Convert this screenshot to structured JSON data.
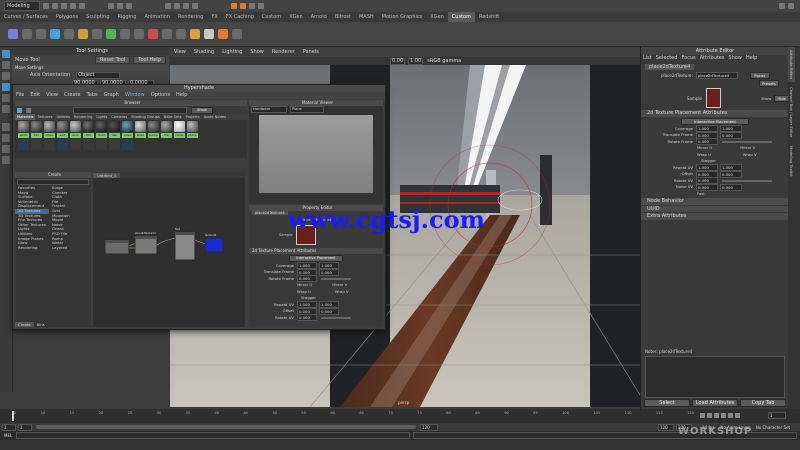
{
  "menu": {
    "mode": "Modeling"
  },
  "shelf": {
    "tabs": [
      "Curves / Surfaces",
      "Polygons",
      "Sculpting",
      "Rigging",
      "Animation",
      "Rendering",
      "FX",
      "FX Caching",
      "Custom",
      "XGen",
      "Arnold",
      "Bifrost",
      "MASH",
      "Motion Graphics",
      "XGen",
      "Custom",
      "Redshift"
    ],
    "active_index": 15,
    "accent": "#e07b2a"
  },
  "tool_settings": {
    "title": "Tool Settings",
    "tool": "Move Tool",
    "reset": "Reset Tool",
    "help": "Tool Help",
    "section": "Move Settings",
    "axis_label": "Axis Orientation",
    "axis_value": "Object",
    "coords": [
      "90.0000",
      "90.0000",
      "0.0000"
    ]
  },
  "viewport": {
    "menus": [
      "View",
      "Shading",
      "Lighting",
      "Show",
      "Renderer",
      "Panels"
    ],
    "gamma": "sRGB gamma",
    "values": [
      "0.00",
      "1.00"
    ],
    "camera": "persp"
  },
  "hypershade": {
    "title": "Hypershade",
    "menus": [
      "File",
      "Edit",
      "View",
      "Create",
      "Tabs",
      "Graph",
      "Window",
      "Options",
      "Help"
    ],
    "hot_menu_index": 6,
    "browser_title": "Browser",
    "browser_tabs": [
      "Materials",
      "Textures",
      "Utilities",
      "Rendering",
      "Lights",
      "Cameras",
      "Shading Groups",
      "Bake Sets",
      "Projects",
      "Asset Nodes"
    ],
    "show_label": "Show",
    "swatch_labels": [
      "lamb",
      "blin",
      "phon",
      "surf",
      "anis",
      "stin",
      "fluid",
      "hair",
      "ocea",
      "shad",
      "bump",
      "file",
      "ramp",
      "place"
    ],
    "material_viewer_title": "Material Viewer",
    "material_viewer_options": [
      "Hardware",
      "Plane"
    ],
    "create_title": "Create",
    "create_tree": [
      "Favorites",
      "Maya",
      "Surface",
      "Volumetric",
      "Displacement",
      "2D Textures",
      "3D Textures",
      "Env Textures",
      "Other Textures",
      "Lights",
      "Utilities",
      "Image Planes",
      "Glow",
      "Rendering"
    ],
    "create_selected": 5,
    "create_nodes": [
      "Bulge",
      "Checker",
      "Cloth",
      "File",
      "Fractal",
      "Grid",
      "Mountain",
      "Movie",
      "Noise",
      "Ocean",
      "PSD File",
      "Ramp",
      "Water",
      "Layered"
    ],
    "work_tab": "Untitled_1",
    "create_tab": "Create",
    "bins_tab": "Bins",
    "node_labels": [
      "place2dTexture4",
      "file1",
      "lambert2"
    ]
  },
  "property_editor": {
    "title": "Property Editor",
    "node_tab": "place2dTexture4",
    "node_name": "place2dTexture4",
    "sample": "Sample",
    "section": "2d Texture Placement Attributes",
    "interactive": "Interactive Placement",
    "rows": [
      {
        "label": "Coverage",
        "a": "1.000",
        "b": "1.000"
      },
      {
        "label": "Translate Frame",
        "a": "0.000",
        "b": "0.000"
      },
      {
        "label": "Rotate Frame",
        "a": "0.000",
        "b": ""
      }
    ],
    "checks": [
      "Mirror U",
      "Mirror V",
      "Wrap U",
      "Wrap V",
      "Stagger"
    ],
    "rows2": [
      {
        "label": "Repeat UV",
        "a": "1.000",
        "b": "1.000"
      },
      {
        "label": "Offset",
        "a": "0.000",
        "b": "0.000"
      },
      {
        "label": "Rotate UV",
        "a": "0.000",
        "b": ""
      }
    ]
  },
  "attribute_editor": {
    "title": "Attribute Editor",
    "menus": [
      "List",
      "Selected",
      "Focus",
      "Attributes",
      "Show",
      "Help"
    ],
    "node_tab": "place2dTexture4",
    "field_label": "place2dTexture:",
    "field_value": "place2dTexture4",
    "focus": "Focus",
    "presets": "Presets",
    "show": "Show",
    "hide": "Hide",
    "sample": "Sample",
    "section": "2d Texture Placement Attributes",
    "interactive": "Interactive Placement",
    "rows": [
      {
        "label": "Coverage",
        "a": "1.000",
        "b": "1.000"
      },
      {
        "label": "Translate Frame",
        "a": "0.000",
        "b": "0.000"
      },
      {
        "label": "Rotate Frame",
        "a": "0.000",
        "b": ""
      }
    ],
    "checks": [
      "Mirror U",
      "Mirror V",
      "Wrap U",
      "Wrap V",
      "Stagger"
    ],
    "rows2": [
      {
        "label": "Repeat UV",
        "a": "1.000",
        "b": "1.000"
      },
      {
        "label": "Offset",
        "a": "0.000",
        "b": "0.000"
      },
      {
        "label": "Rotate UV",
        "a": "0.000",
        "b": ""
      },
      {
        "label": "Noise UV",
        "a": "0.000",
        "b": "0.000"
      }
    ],
    "fast": "Fast",
    "sections": [
      "Node Behavior",
      "UUID",
      "Extra Attributes"
    ],
    "notes": "Notes: place2dTexture4",
    "buttons": [
      "Select",
      "Load Attributes",
      "Copy Tab"
    ],
    "side_tabs": [
      "Attribute Editor",
      "Channel Box / Layer Editor",
      "Modeling Toolkit"
    ]
  },
  "timeline": {
    "ticks": [
      "5",
      "10",
      "15",
      "20",
      "25",
      "30",
      "35",
      "40",
      "45",
      "50",
      "55",
      "60",
      "65",
      "70",
      "75",
      "80",
      "85",
      "90",
      "95",
      "100",
      "105",
      "110",
      "115",
      "120"
    ],
    "current": "1",
    "range_start": "1",
    "range_inner_start": "1",
    "range_inner_end": "120",
    "range_end": "120",
    "range_a": "120",
    "range_b": "200",
    "anim_layer": "No Anim Layer",
    "char_set": "No Character Set",
    "fps": "24 fps",
    "mel": "MEL"
  },
  "watermark": "www.cgtsj.com",
  "brand": "WORKSHOP"
}
